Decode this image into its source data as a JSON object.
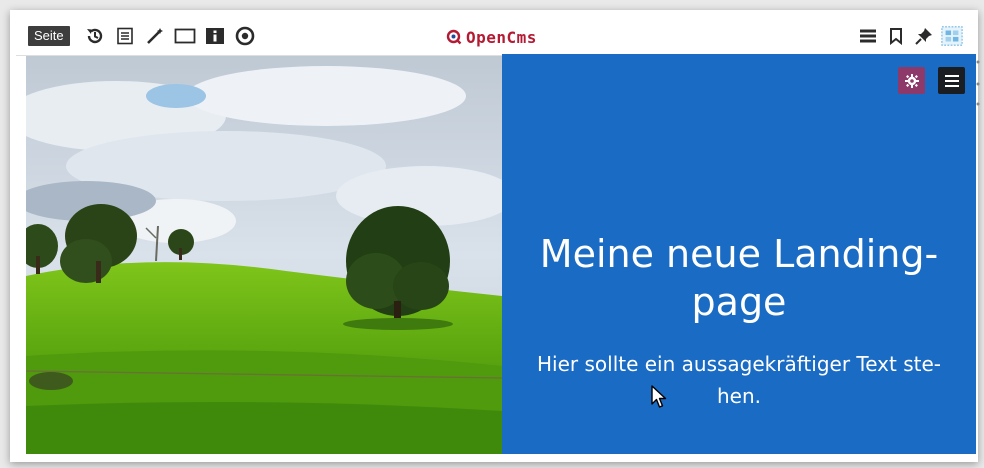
{
  "toolbar": {
    "page_label": "Seite",
    "logo_text": "OpenCms",
    "brand_color": "#b31b34",
    "left_icons": [
      "history-icon",
      "page-list-icon",
      "wand-icon",
      "frame-icon",
      "info-icon",
      "publish-circle-icon"
    ],
    "right_icons": [
      "menu-icon",
      "bookmark-icon",
      "pin-icon",
      "gallery-icon"
    ]
  },
  "hero": {
    "title": "Meine neue Landing-page",
    "text": "Hier sollte ein aussagekräftiger Text ste-hen.",
    "panel_color": "#1a6bc4",
    "image_description": "green-hill-landscape",
    "edit_icons": [
      "gear-icon",
      "menu-icon"
    ]
  }
}
